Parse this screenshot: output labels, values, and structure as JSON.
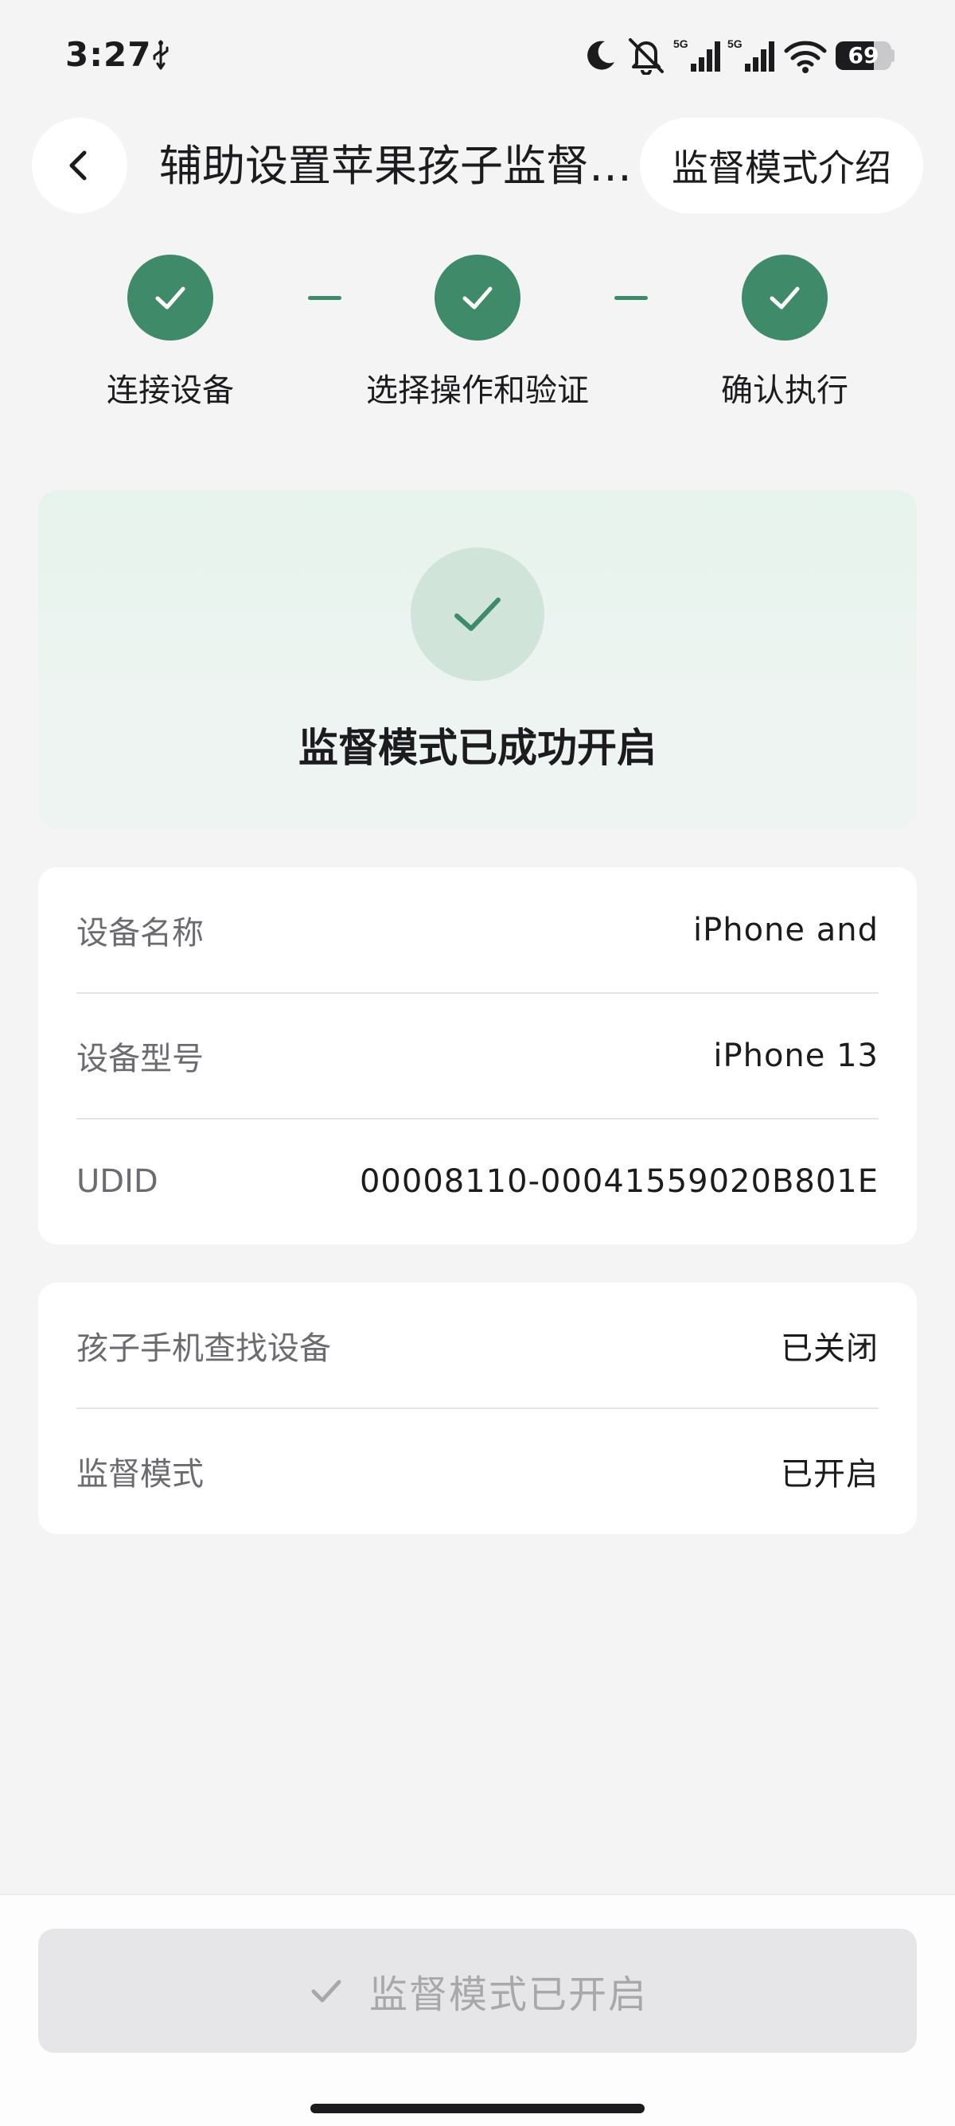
{
  "status_bar": {
    "time": "3:27",
    "battery_level": "69",
    "signal_badge_1": "5G",
    "signal_badge_2": "5G",
    "icons": [
      "usb-icon",
      "moon-icon",
      "bell-off-icon",
      "signal-icon",
      "signal-icon",
      "wifi-icon",
      "battery-icon"
    ]
  },
  "header": {
    "title": "辅助设置苹果孩子监督模式",
    "intro_button": "监督模式介绍"
  },
  "stepper": {
    "steps": [
      {
        "label": "连接设备",
        "done": true
      },
      {
        "label": "选择操作和验证",
        "done": true
      },
      {
        "label": "确认执行",
        "done": true
      }
    ]
  },
  "success": {
    "title": "监督模式已成功开启"
  },
  "device_info": [
    {
      "label": "设备名称",
      "value": "iPhone and"
    },
    {
      "label": "设备型号",
      "value": "iPhone 13"
    },
    {
      "label": "UDID",
      "value": "00008110-00041559020B801E"
    }
  ],
  "status_info": [
    {
      "label": "孩子手机查找设备",
      "value": "已关闭"
    },
    {
      "label": "监督模式",
      "value": "已开启"
    }
  ],
  "footer": {
    "button_label": "监督模式已开启"
  },
  "colors": {
    "accent": "#3f8a68",
    "success_bg": "#e9f3ee",
    "page_bg": "#f4f4f5",
    "disabled_button": "#e6e6e8"
  }
}
